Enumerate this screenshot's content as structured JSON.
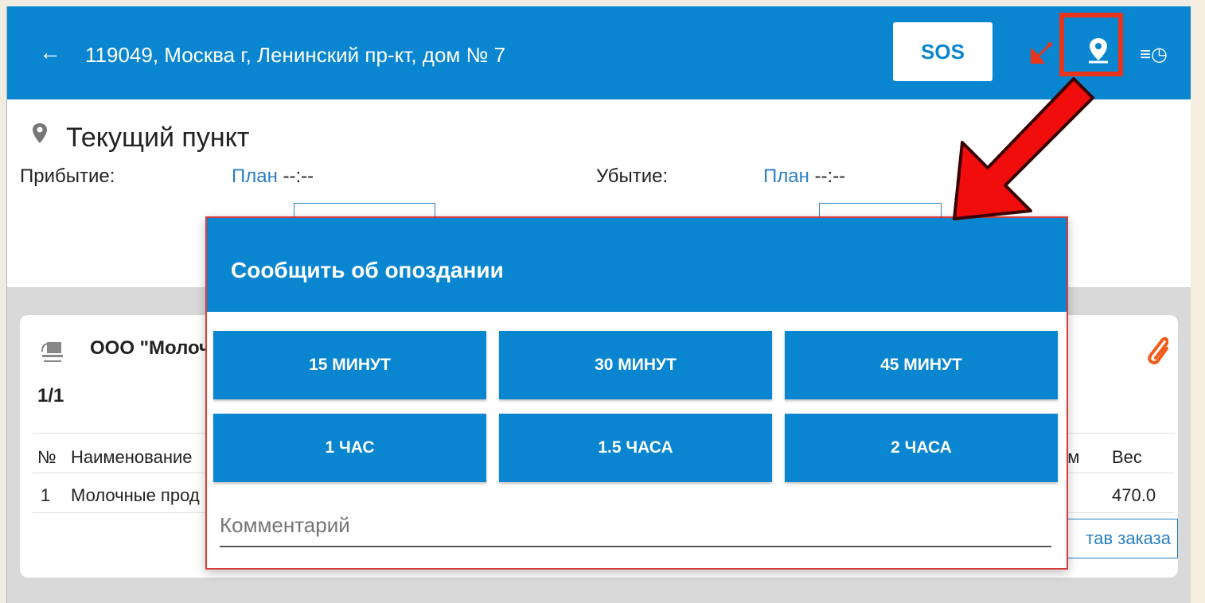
{
  "appbar": {
    "back_icon": "back-arrow-icon",
    "address": "119049, Москва г, Ленинский пр-кт, дом № 7",
    "sos_label": "SOS",
    "icons": [
      "satellite-icon",
      "location-pin-icon",
      "history-icon"
    ]
  },
  "point": {
    "title": "Текущий пункт",
    "arrival_label": "Прибытие:",
    "departure_label": "Убытие:",
    "plan_word": "План",
    "arrival_time": "--:--",
    "departure_time": "--:--"
  },
  "order": {
    "org": "ООО \"Молочн",
    "counter": "1/1",
    "columns": {
      "no": "№",
      "name": "Наименование",
      "volume_tail": "ем",
      "weight": "Вес"
    },
    "rows": [
      {
        "no": "1",
        "name": "Молочные прод",
        "weight": "470.0"
      }
    ],
    "composition_button": "тав заказа"
  },
  "dialog": {
    "title": "Сообщить об опоздании",
    "options": [
      "15 МИНУТ",
      "30 МИНУТ",
      "45 МИНУТ",
      "1 ЧАС",
      "1.5 ЧАСА",
      "2 ЧАСА"
    ],
    "comment_placeholder": "Комментарий"
  },
  "colors": {
    "primary": "#0a86d0",
    "highlight": "#e8351c",
    "link": "#2a7fc4"
  }
}
